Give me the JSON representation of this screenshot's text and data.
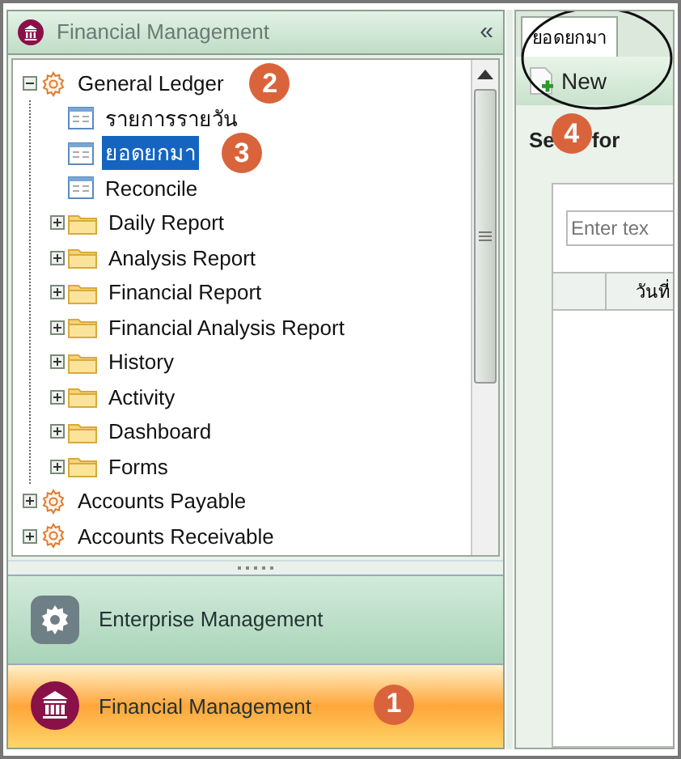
{
  "nav_panel": {
    "title": "Financial Management",
    "collapse_glyph": "«"
  },
  "tree": [
    {
      "label": "General Ledger",
      "kind": "module",
      "expanded": true,
      "selected": false,
      "badge": "2",
      "children": [
        {
          "label": "รายการรายวัน",
          "kind": "document",
          "selected": false
        },
        {
          "label": "ยอดยกมา",
          "kind": "document",
          "selected": true,
          "badge": "3"
        },
        {
          "label": "Reconcile",
          "kind": "document",
          "selected": false
        },
        {
          "label": "Daily Report",
          "kind": "folder",
          "expanded": false,
          "selected": false
        },
        {
          "label": "Analysis Report",
          "kind": "folder",
          "expanded": false,
          "selected": false
        },
        {
          "label": "Financial Report",
          "kind": "folder",
          "expanded": false,
          "selected": false
        },
        {
          "label": "Financial Analysis Report",
          "kind": "folder",
          "expanded": false,
          "selected": false
        },
        {
          "label": "History",
          "kind": "folder",
          "expanded": false,
          "selected": false
        },
        {
          "label": "Activity",
          "kind": "folder",
          "expanded": false,
          "selected": false
        },
        {
          "label": "Dashboard",
          "kind": "folder",
          "expanded": false,
          "selected": false
        },
        {
          "label": "Forms",
          "kind": "folder",
          "expanded": false,
          "selected": false
        }
      ]
    },
    {
      "label": "Accounts Payable",
      "kind": "module",
      "expanded": false,
      "selected": false
    },
    {
      "label": "Accounts Receivable",
      "kind": "module",
      "expanded": false,
      "selected": false
    }
  ],
  "modules": [
    {
      "label": "Enterprise Management",
      "kind": "gear",
      "selected": false
    },
    {
      "label": "Financial Management",
      "kind": "bank",
      "selected": true,
      "badge": "1"
    }
  ],
  "tabs": [
    {
      "label": "ยอดยกมา",
      "selected": true
    }
  ],
  "toolbar": {
    "new_button": "New",
    "badge": "4"
  },
  "search": {
    "label_parts": [
      "Se",
      "for"
    ],
    "placeholder": "Enter tex"
  },
  "table": {
    "columns": [
      "",
      "วันที่"
    ]
  }
}
